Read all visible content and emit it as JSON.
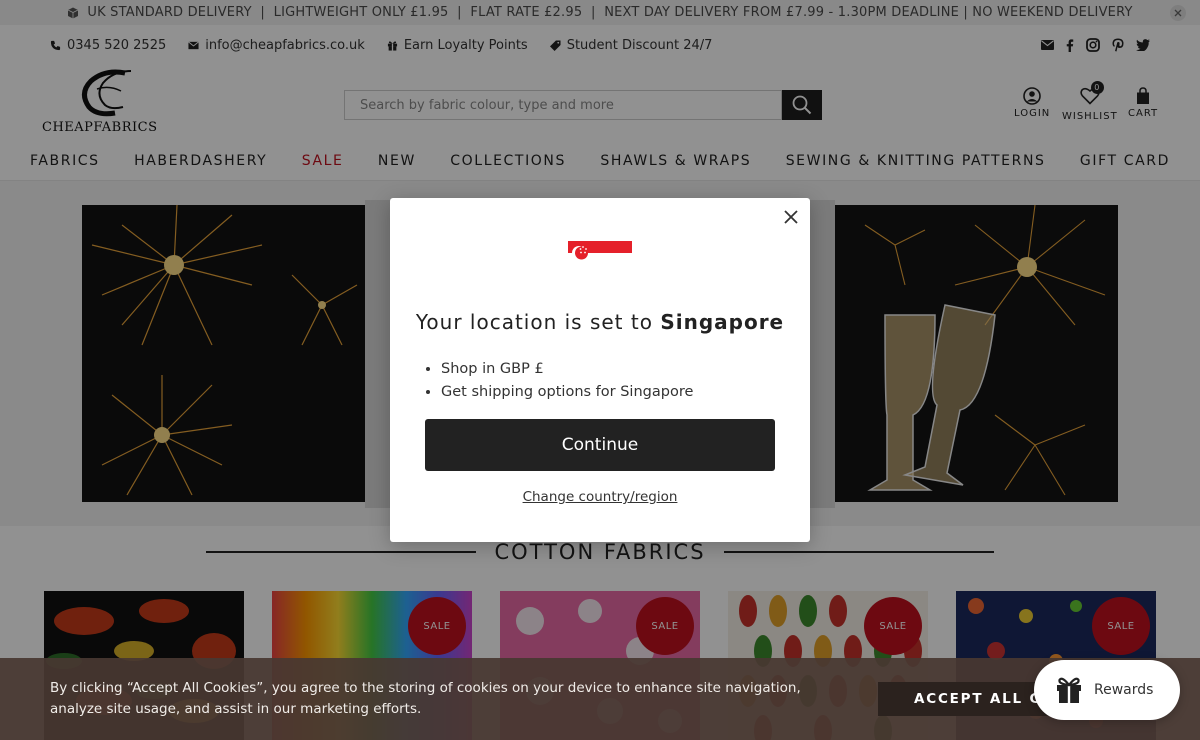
{
  "announcement": {
    "text": "UK STANDARD DELIVERY  |  LIGHTWEIGHT ONLY £1.95  |  FLAT RATE £2.95  |  NEXT DAY DELIVERY FROM £7.99 - 1.30PM DEADLINE | NO WEEKEND DELIVERY",
    "close_icon": "close-icon"
  },
  "contact": {
    "phone": "0345 520 2525",
    "email": "info@cheapfabrics.co.uk",
    "loyalty": "Earn Loyalty Points",
    "student": "Student Discount 24/7"
  },
  "logo": {
    "text": "CHEAPFABRICS"
  },
  "search": {
    "placeholder": "Search by fabric colour, type and more"
  },
  "account": {
    "login": "LOGIN",
    "wishlist": "WISHLIST",
    "wishlist_count": "0",
    "cart": "CART"
  },
  "nav": {
    "items": [
      "FABRICS",
      "HABERDASHERY",
      "SALE",
      "NEW",
      "COLLECTIONS",
      "SHAWLS & WRAPS",
      "SEWING & KNITTING PATTERNS",
      "GIFT CARD"
    ]
  },
  "section": {
    "title": "COTTON FABRICS"
  },
  "products": {
    "sale_label": "SALE"
  },
  "modal": {
    "title_prefix": "Your location is set to ",
    "country": "Singapore",
    "bullet1": "Shop in GBP £",
    "bullet2": "Get shipping options for Singapore",
    "continue": "Continue",
    "change": "Change country/region"
  },
  "cookie": {
    "message": "By clicking “Accept All Cookies”, you agree to the storing of cookies on your device to enhance site navigation, analyze site usage, and assist in our marketing efforts.",
    "accept": "ACCEPT ALL COOKIES"
  },
  "rewards": {
    "label": "Rewards"
  },
  "colors": {
    "sale_red": "#c0111f",
    "dark": "#222222",
    "cookie_bg": "#483831"
  }
}
